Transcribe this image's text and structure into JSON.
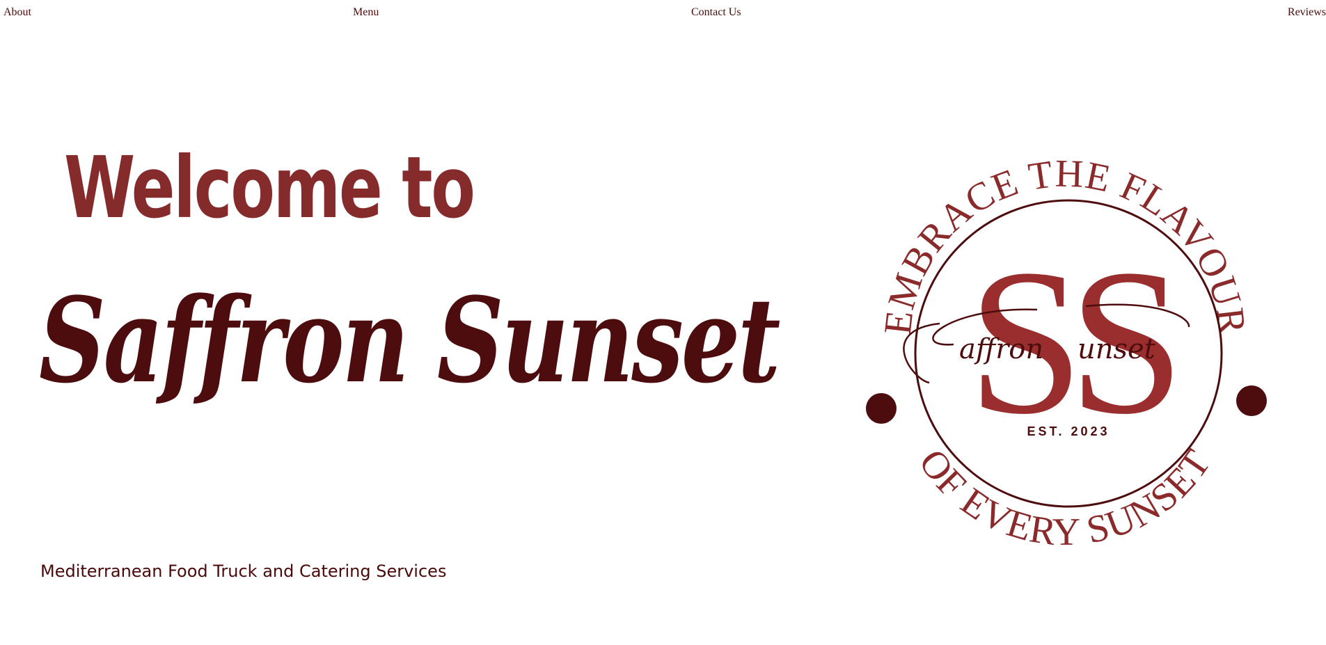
{
  "nav": {
    "about": "About",
    "menu": "Menu",
    "contact": "Contact Us",
    "reviews": "Reviews"
  },
  "hero": {
    "welcome": "Welcome to",
    "brand": "Saffron Sunset",
    "tagline": "Mediterranean Food Truck and Catering Services"
  },
  "emblem": {
    "arc_top": "EMBRACE THE FLAVOUR",
    "arc_bottom": "OF EVERY SUNSET",
    "monogram": "SS",
    "script_left": "affron",
    "script_right": "unset",
    "established": "EST. 2023",
    "icons": [
      "dot-left-icon",
      "dot-right-icon"
    ]
  },
  "colors": {
    "primary_dark": "#4d0c0d",
    "primary_red": "#862b2c",
    "emblem_red": "#9a2d2e",
    "background": "#ffffff"
  }
}
